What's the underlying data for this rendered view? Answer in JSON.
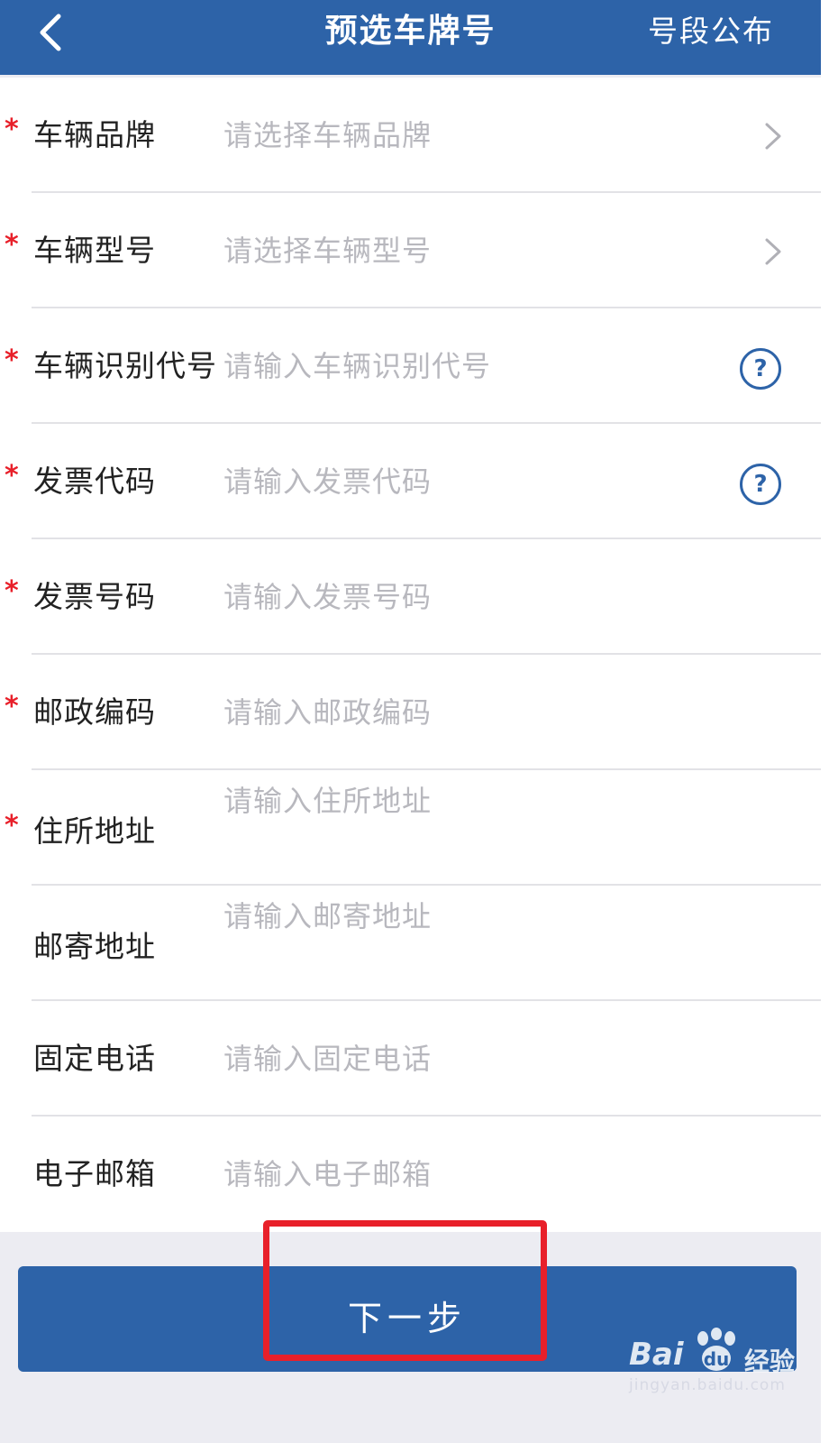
{
  "header": {
    "title": "预选车牌号",
    "action_label": "号段公布"
  },
  "form": {
    "rows": [
      {
        "label": "车辆品牌",
        "required": true,
        "type": "select",
        "placeholder": "请选择车辆品牌",
        "trailing": "chevron-right-icon"
      },
      {
        "label": "车辆型号",
        "required": true,
        "type": "select",
        "placeholder": "请选择车辆型号",
        "trailing": "chevron-right-icon"
      },
      {
        "label": "车辆识别代号",
        "required": true,
        "type": "input",
        "placeholder": "请输入车辆识别代号",
        "trailing": "help-icon"
      },
      {
        "label": "发票代码",
        "required": true,
        "type": "input",
        "placeholder": "请输入发票代码",
        "trailing": "help-icon"
      },
      {
        "label": "发票号码",
        "required": true,
        "type": "input",
        "placeholder": "请输入发票号码"
      },
      {
        "label": "邮政编码",
        "required": true,
        "type": "input",
        "placeholder": "请输入邮政编码"
      },
      {
        "label": "住所地址",
        "required": true,
        "type": "textarea",
        "placeholder": "请输入住所地址"
      },
      {
        "label": "邮寄地址",
        "required": false,
        "type": "textarea",
        "placeholder": "请输入邮寄地址"
      },
      {
        "label": "固定电话",
        "required": false,
        "type": "input",
        "placeholder": "请输入固定电话"
      },
      {
        "label": "电子邮箱",
        "required": false,
        "type": "input",
        "placeholder": "请输入电子邮箱"
      }
    ],
    "required_mark": "*",
    "help_mark": "?"
  },
  "footer": {
    "next_label": "下一步"
  },
  "watermark": {
    "logo": "Bai",
    "logo_suffix": "经验",
    "url": "jingyan.baidu.com"
  },
  "colors": {
    "brand_blue": "#2d63a8",
    "required_red": "#e8202a",
    "highlight_red": "#e8202a",
    "placeholder_gray": "#b8b8be",
    "background": "#ececf2"
  }
}
